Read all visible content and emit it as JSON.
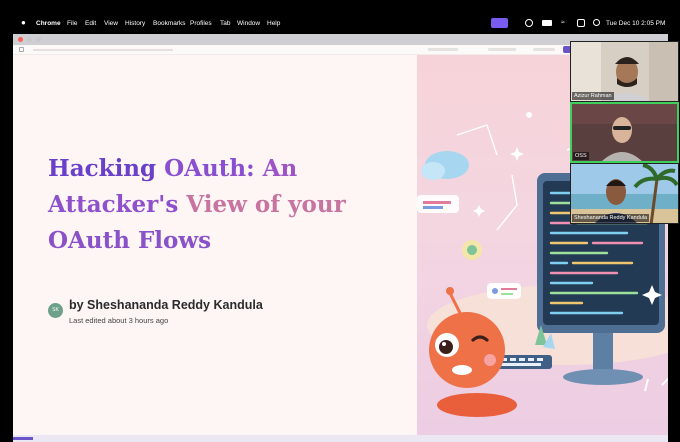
{
  "menubar": {
    "app_name": "Chrome",
    "items": [
      "File",
      "Edit",
      "View",
      "History",
      "Bookmarks",
      "Profiles",
      "Tab",
      "Window",
      "Help"
    ],
    "clock": "Tue Dec 10  2:05 PM"
  },
  "slide": {
    "title_lines": [
      "Hacking OAuth: An",
      "Attacker's View of your",
      "OAuth Flows"
    ],
    "author": "by Sheshananda Reddy Kandula",
    "edited": "Last edited about 3 hours ago",
    "avatar_initials": "SK",
    "progress_fraction": 0.03
  },
  "participants": [
    {
      "name": "Azizur Rahman"
    },
    {
      "name": "OSS",
      "active": true
    },
    {
      "name": "Sheshananda Reddy Kandula"
    }
  ],
  "colors": {
    "title_gradient_start": "#6a3fc9",
    "title_gradient_end": "#e0846d",
    "accent": "#6b53c8",
    "active_speaker": "#3fcf5c"
  }
}
